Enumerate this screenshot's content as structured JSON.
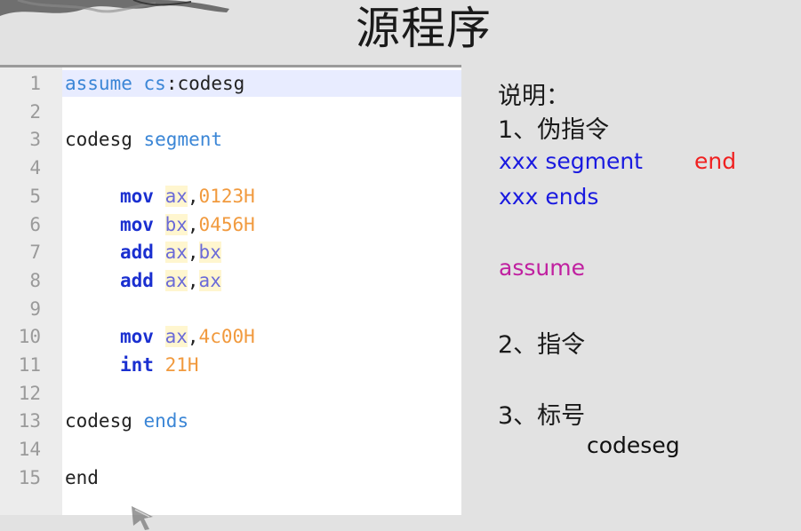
{
  "title": "源程序",
  "colors": {
    "accent_directive": "#3b86d6",
    "mnemonic": "#1a2fd0",
    "register": "#6a6ad8",
    "number": "#f19a3e",
    "note_blue": "#1a1ae0",
    "note_red": "#f02020",
    "note_magenta": "#c020a0"
  },
  "editor": {
    "lines": [
      {
        "num": "1",
        "tokens": [
          {
            "t": "assume",
            "c": "kw-directive"
          },
          {
            "t": " ",
            "c": "plain"
          },
          {
            "t": "cs",
            "c": "kw-directive"
          },
          {
            "t": ":codesg",
            "c": "plain"
          }
        ]
      },
      {
        "num": "2",
        "tokens": []
      },
      {
        "num": "3",
        "tokens": [
          {
            "t": "codesg",
            "c": "plain"
          },
          {
            "t": " ",
            "c": "plain"
          },
          {
            "t": "segment",
            "c": "kw-directive"
          }
        ]
      },
      {
        "num": "4",
        "tokens": []
      },
      {
        "num": "5",
        "indent": true,
        "tokens": [
          {
            "t": "mov",
            "c": "kw-mnemonic"
          },
          {
            "t": " ",
            "c": "plain"
          },
          {
            "t": "ax",
            "c": "reg"
          },
          {
            "t": ",",
            "c": "plain"
          },
          {
            "t": "0123H",
            "c": "num"
          }
        ]
      },
      {
        "num": "6",
        "indent": true,
        "tokens": [
          {
            "t": "mov",
            "c": "kw-mnemonic"
          },
          {
            "t": " ",
            "c": "plain"
          },
          {
            "t": "bx",
            "c": "reg"
          },
          {
            "t": ",",
            "c": "plain"
          },
          {
            "t": "0456H",
            "c": "num"
          }
        ]
      },
      {
        "num": "7",
        "indent": true,
        "tokens": [
          {
            "t": "add",
            "c": "kw-mnemonic"
          },
          {
            "t": " ",
            "c": "plain"
          },
          {
            "t": "ax",
            "c": "reg"
          },
          {
            "t": ",",
            "c": "plain"
          },
          {
            "t": "bx",
            "c": "reg"
          }
        ]
      },
      {
        "num": "8",
        "indent": true,
        "tokens": [
          {
            "t": "add",
            "c": "kw-mnemonic"
          },
          {
            "t": " ",
            "c": "plain"
          },
          {
            "t": "ax",
            "c": "reg"
          },
          {
            "t": ",",
            "c": "plain"
          },
          {
            "t": "ax",
            "c": "reg"
          }
        ]
      },
      {
        "num": "9",
        "tokens": []
      },
      {
        "num": "10",
        "indent": true,
        "tokens": [
          {
            "t": "mov",
            "c": "kw-mnemonic"
          },
          {
            "t": " ",
            "c": "plain"
          },
          {
            "t": "ax",
            "c": "reg"
          },
          {
            "t": ",",
            "c": "plain"
          },
          {
            "t": "4c00H",
            "c": "num"
          }
        ]
      },
      {
        "num": "11",
        "indent": true,
        "tokens": [
          {
            "t": "int",
            "c": "kw-mnemonic"
          },
          {
            "t": " ",
            "c": "plain"
          },
          {
            "t": "21H",
            "c": "num"
          }
        ]
      },
      {
        "num": "12",
        "tokens": []
      },
      {
        "num": "13",
        "tokens": [
          {
            "t": "codesg",
            "c": "plain"
          },
          {
            "t": " ",
            "c": "plain"
          },
          {
            "t": "ends",
            "c": "kw-directive"
          }
        ]
      },
      {
        "num": "14",
        "tokens": []
      },
      {
        "num": "15",
        "tokens": [
          {
            "t": "end",
            "c": "plain"
          }
        ]
      }
    ]
  },
  "notes": {
    "heading": "说明：",
    "item1": "1、伪指令",
    "segment_line": "xxx segment",
    "end_word": "end",
    "ends_line": "xxx ends",
    "assume_word": "assume",
    "item2": "2、指令",
    "item3": "3、标号",
    "label_example": "codeseg"
  }
}
